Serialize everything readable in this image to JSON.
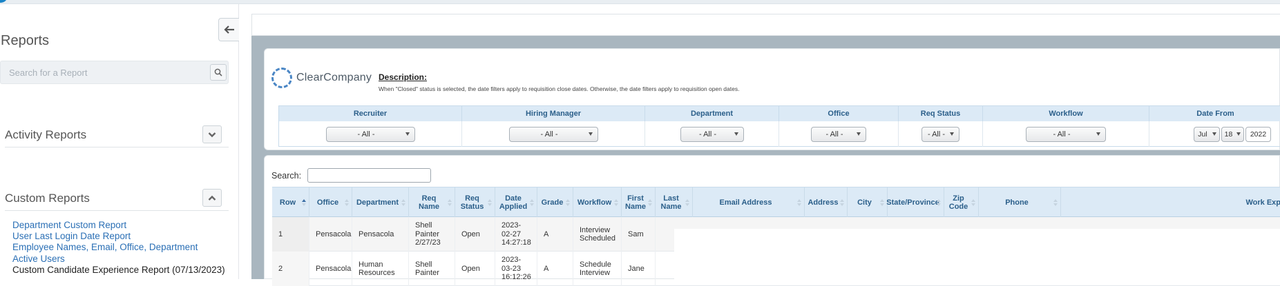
{
  "sidebar": {
    "title": "Reports",
    "search_placeholder": "Search for a Report",
    "sections": [
      {
        "label": "Activity Reports",
        "state": "collapsed"
      },
      {
        "label": "Custom Reports",
        "state": "expanded"
      }
    ],
    "custom_reports": [
      "Department Custom Report",
      "User Last Login Date Report",
      "Employee Names, Email, Office, Department",
      "Active Users",
      "Custom Candidate Experience Report (07/13/2023)"
    ]
  },
  "report": {
    "logo_text": "ClearCompany",
    "description_title": "Description:",
    "description_text": "When \"Closed\" status is selected, the date filters apply to requisition close dates. Otherwise, the date filters apply to requisition open dates.",
    "filters": [
      {
        "label": "Recruiter",
        "value": "- All -"
      },
      {
        "label": "Hiring Manager",
        "value": "- All -"
      },
      {
        "label": "Department",
        "value": "- All -"
      },
      {
        "label": "Office",
        "value": "- All -"
      },
      {
        "label": "Req Status",
        "value": "- All -"
      },
      {
        "label": "Workflow",
        "value": "- All -"
      },
      {
        "label": "Date From",
        "month": "Jul",
        "day": "18",
        "year": "2022"
      }
    ]
  },
  "grid": {
    "search_label": "Search:",
    "search_value": "",
    "columns": [
      "Row",
      "Office",
      "Department",
      "Req Name",
      "Req Status",
      "Date Applied",
      "Grade",
      "Workflow",
      "First Name",
      "Last Name",
      "Email Address",
      "Address",
      "City",
      "State/Province",
      "Zip Code",
      "Phone",
      "Work Exp"
    ],
    "sorted_column": "Row",
    "rows": [
      {
        "row": "1",
        "office": "Pensacola",
        "department": "Pensacola",
        "req_name": "Shell Painter 2/27/23",
        "req_status": "Open",
        "date_applied": "2023-02-27 14:27:18",
        "grade": "A",
        "workflow": "Interview Scheduled",
        "first_name": "Sam"
      },
      {
        "row": "2",
        "office": "Pensacola",
        "department": "Human Resources",
        "req_name": "Shell Painter",
        "req_status": "Open",
        "date_applied": "2023-03-23 16:12:26",
        "grade": "A",
        "workflow": "Schedule Interview",
        "first_name": "Jane"
      }
    ]
  },
  "colors": {
    "link": "#2a6fb5",
    "header_bg": "#dceaf6",
    "header_text": "#2b5f8a",
    "page_bg": "#a9b6bf"
  }
}
